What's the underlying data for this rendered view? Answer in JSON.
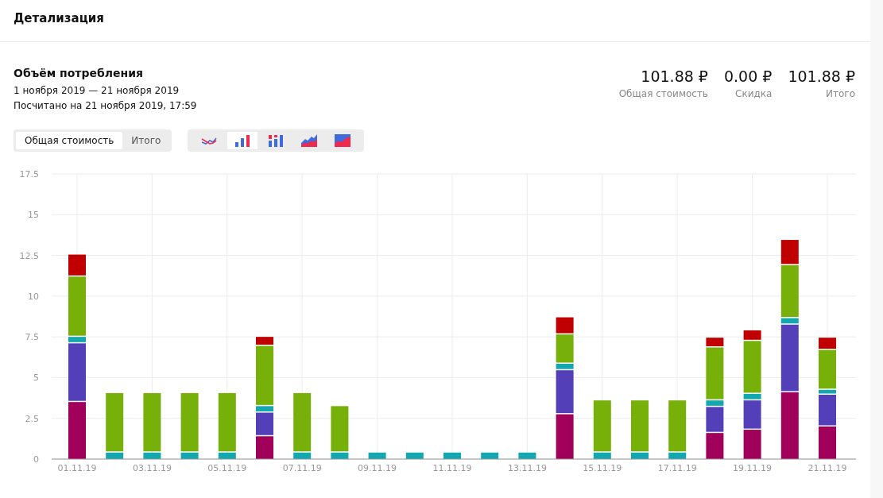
{
  "page_title": "Детализация",
  "section": {
    "title": "Объём потребления",
    "period": "1 ноября 2019 — 21 ноября 2019",
    "calculated": "Посчитано на 21 ноября 2019, 17:59"
  },
  "totals": [
    {
      "value": "101.88 ₽",
      "label": "Общая стоимость"
    },
    {
      "value": "0.00 ₽",
      "label": "Скидка"
    },
    {
      "value": "101.88 ₽",
      "label": "Итого"
    }
  ],
  "metric_tabs": [
    {
      "label": "Общая стоимость",
      "selected": true
    },
    {
      "label": "Итого",
      "selected": false
    }
  ],
  "chart_types": [
    {
      "kind": "line",
      "selected": false
    },
    {
      "kind": "bar",
      "selected": true
    },
    {
      "kind": "stacked",
      "selected": false
    },
    {
      "kind": "area",
      "selected": false
    },
    {
      "kind": "area100",
      "selected": false
    }
  ],
  "chart_data": {
    "type": "bar",
    "stacked": true,
    "grid": true,
    "categories": [
      "01.11.19",
      null,
      "03.11.19",
      null,
      "05.11.19",
      null,
      "07.11.19",
      null,
      "09.11.19",
      null,
      "11.11.19",
      null,
      "13.11.19",
      null,
      "15.11.19",
      null,
      "17.11.19",
      null,
      "19.11.19",
      null,
      "21.11.19"
    ],
    "yticks": [
      0,
      {
        "value": 2.5,
        "label": "2.5"
      },
      {
        "value": 5,
        "label": "5"
      },
      {
        "value": 7.5,
        "label": "7.5"
      },
      {
        "value": 10,
        "label": "10"
      },
      {
        "value": 12.5,
        "label": "12.5"
      },
      {
        "value": 15,
        "label": "15"
      },
      {
        "value": 17.5,
        "label": "17.5"
      }
    ],
    "ylim": [
      0,
      17.5
    ],
    "series": [
      {
        "color": "#a0005a",
        "values": [
          3.5,
          0,
          0,
          0,
          0,
          1.4,
          0,
          0,
          0,
          0,
          0,
          0,
          0,
          2.75,
          0,
          0,
          0,
          1.6,
          1.8,
          4.1,
          2.0
        ]
      },
      {
        "color": "#5340b8",
        "values": [
          3.6,
          0,
          0,
          0,
          0,
          1.45,
          0,
          0,
          0,
          0,
          0,
          0,
          0,
          2.7,
          0,
          0,
          0,
          1.6,
          1.8,
          4.15,
          1.95
        ]
      },
      {
        "color": "#13a7b0",
        "values": [
          0.4,
          0.4,
          0.4,
          0.4,
          0.4,
          0.4,
          0.4,
          0.4,
          0.4,
          0.4,
          0.4,
          0.4,
          0.4,
          0.4,
          0.4,
          0.4,
          0.4,
          0.4,
          0.4,
          0.4,
          0.3
        ]
      },
      {
        "color": "#78b00a",
        "values": [
          3.7,
          3.65,
          3.65,
          3.65,
          3.65,
          3.7,
          3.65,
          2.85,
          0,
          0,
          0,
          0,
          0,
          1.8,
          3.2,
          3.2,
          3.2,
          3.25,
          3.25,
          3.25,
          2.45
        ]
      },
      {
        "color": "#c00000",
        "values": [
          1.35,
          0,
          0,
          0,
          0,
          0.55,
          0,
          0,
          0,
          0,
          0,
          0,
          0,
          1.05,
          0,
          0,
          0,
          0.6,
          0.65,
          1.55,
          0.75
        ]
      }
    ]
  }
}
